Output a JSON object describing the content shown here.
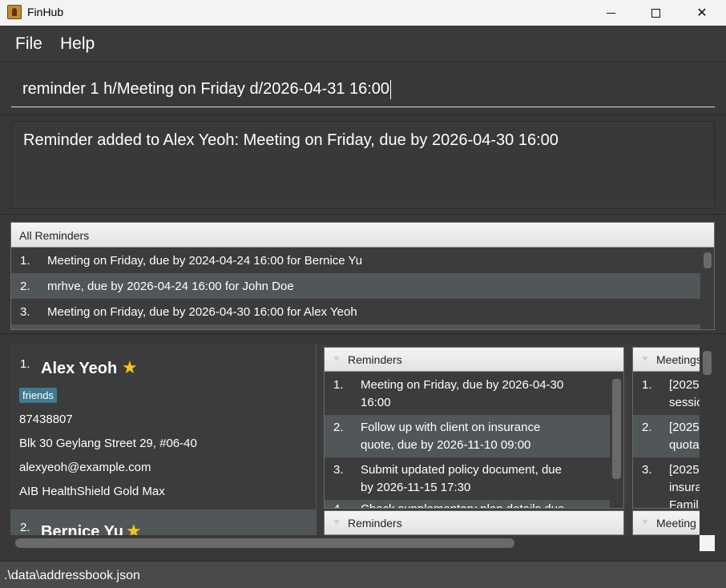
{
  "window": {
    "title": "FinHub"
  },
  "menu": {
    "file": "File",
    "help": "Help"
  },
  "command": {
    "value": "reminder 1 h/Meeting on Friday d/2026-04-31 16:00"
  },
  "result": {
    "text": "Reminder added to Alex Yeoh: Meeting on Friday, due by 2026-04-30 16:00"
  },
  "all_reminders": {
    "title": "All Reminders",
    "items": [
      {
        "num": "1.",
        "text": "Meeting on Friday, due by 2024-04-24 16:00 for Bernice Yu"
      },
      {
        "num": "2.",
        "text": "mrhve, due by 2026-04-24 16:00 for John Doe"
      },
      {
        "num": "3.",
        "text": "Meeting on Friday, due by 2026-04-30 16:00 for Alex Yeoh"
      }
    ]
  },
  "persons": [
    {
      "index": "1.",
      "name": "Alex Yeoh",
      "tag": "friends",
      "phone": "87438807",
      "address": "Blk 30 Geylang Street 29, #06-40",
      "email": "alexyeoh@example.com",
      "policy": "AIB HealthShield Gold Max",
      "reminders_title": "Reminders",
      "reminders": [
        {
          "num": "1.",
          "line1": "Meeting on Friday, due by 2026-04-30",
          "line2": "16:00"
        },
        {
          "num": "2.",
          "line1": "Follow up with client on insurance",
          "line2": "quote, due by 2026-11-10 09:00"
        },
        {
          "num": "3.",
          "line1": "Submit updated policy document, due",
          "line2": "by 2026-11-15 17:30"
        },
        {
          "num": "4.",
          "line1": "Check supplementary plan details due",
          "line2": ""
        }
      ],
      "meetings_title": "Meetings",
      "meetings": [
        {
          "num": "1.",
          "line1": "[2025",
          "line2": "sessio"
        },
        {
          "num": "2.",
          "line1": "[2025",
          "line2": "quota"
        },
        {
          "num": "3.",
          "line1": "[2025",
          "line2": "insura",
          "line3": "Famil"
        }
      ]
    },
    {
      "index": "2.",
      "name": "Bernice Yu",
      "reminders_title": "Reminders",
      "meetings_title": "Meeting"
    }
  ],
  "status": {
    "path": ".\\data\\addressbook.json"
  },
  "colors": {
    "background": "#383838",
    "row_alt": "#515658",
    "tag": "#3e7b91",
    "star": "#f5c518"
  },
  "icons": {
    "favorite": "star-icon",
    "app": "app-icon"
  }
}
